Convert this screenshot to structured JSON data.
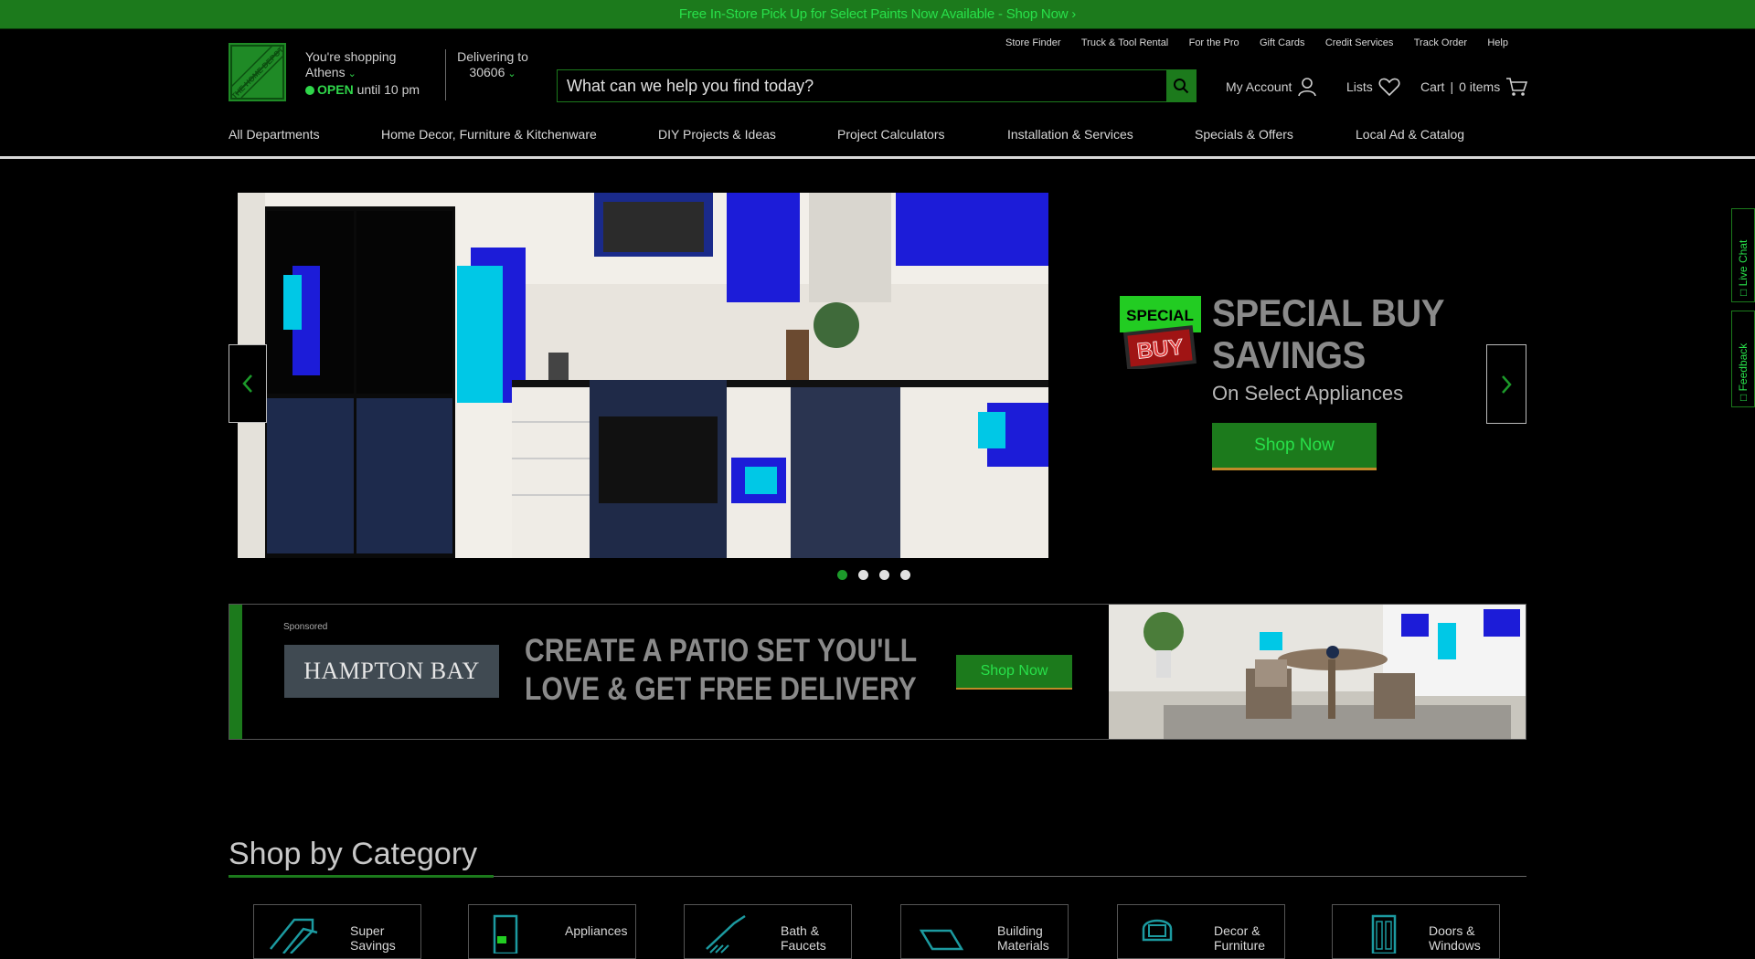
{
  "promo": {
    "text": "Free In-Store Pick Up for Select Paints Now Available - Shop Now ›"
  },
  "util_links": [
    "Store Finder",
    "Truck & Tool Rental",
    "For the Pro",
    "Gift Cards",
    "Credit Services",
    "Track Order",
    "Help"
  ],
  "logo": {
    "text": "THE HOME DEPOT"
  },
  "store": {
    "line1": "You're shopping",
    "city": "Athens",
    "open": "OPEN",
    "until": "until 10 pm"
  },
  "delivery": {
    "line1": "Delivering to",
    "zip": "30606"
  },
  "search": {
    "placeholder": "What can we help you find today?"
  },
  "account": {
    "label": "My Account"
  },
  "lists": {
    "label": "Lists"
  },
  "cart": {
    "label": "Cart",
    "items": "0 items"
  },
  "nav": [
    "All Departments",
    "Home Decor, Furniture & Kitchenware",
    "DIY Projects & Ideas",
    "Project Calculators",
    "Installation & Services",
    "Specials & Offers",
    "Local Ad & Catalog"
  ],
  "hero": {
    "badge_top": "SPECIAL",
    "badge_bottom": "BUY",
    "title_line1": "SPECIAL BUY",
    "title_line2": "SAVINGS",
    "subtitle": "On Select Appliances",
    "cta": "Shop Now",
    "slides": 4,
    "active_slide": 1
  },
  "banner": {
    "sponsored": "Sponsored",
    "brand": "HAMPTON BAY",
    "headline_line1": "CREATE A PATIO SET YOU'LL",
    "headline_line2": "LOVE & GET FREE DELIVERY",
    "cta": "Shop Now"
  },
  "categories": {
    "title": "Shop by Category",
    "items": [
      {
        "label": "Super Savings",
        "icon": "tag-icon"
      },
      {
        "label": "Appliances",
        "icon": "refrigerator-icon"
      },
      {
        "label": "Bath & Faucets",
        "icon": "faucet-icon"
      },
      {
        "label": "Building Materials",
        "icon": "lumber-icon"
      },
      {
        "label": "Decor & Furniture",
        "icon": "chair-icon"
      },
      {
        "label": "Doors & Windows",
        "icon": "door-icon"
      }
    ]
  },
  "side_tabs": {
    "live_chat": "Live Chat",
    "feedback": "Feedback"
  },
  "colors": {
    "brand_green": "#1c7a1c",
    "accent_green": "#28e04a",
    "background": "#000000"
  }
}
